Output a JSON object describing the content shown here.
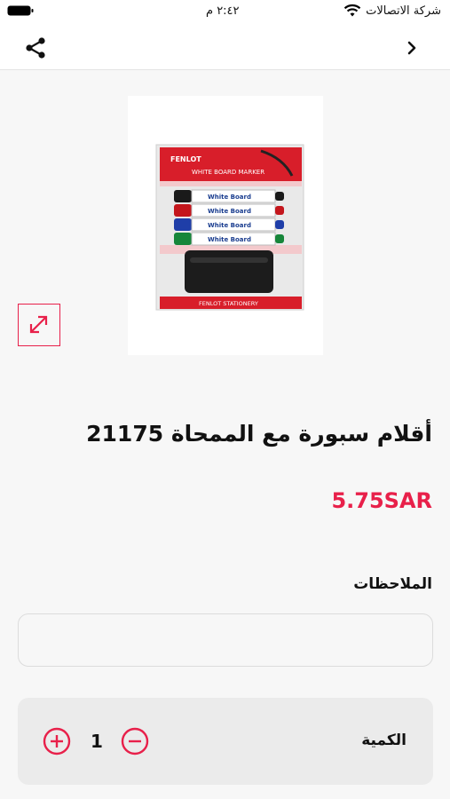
{
  "status_bar": {
    "carrier": "شركة الاتصالات",
    "time": "٢:٤٢ م"
  },
  "product": {
    "title": "أقلام سبورة مع الممحاة 21175",
    "price": "5.75SAR",
    "image": {
      "brand": "FENLOT",
      "header": "WHITE BOARD MARKER",
      "footer": "FENLOT STATIONERY",
      "marker_label": "White Board"
    }
  },
  "notes": {
    "label": "الملاحظات",
    "value": "",
    "placeholder": ""
  },
  "quantity": {
    "label": "الكمية",
    "value": "1"
  },
  "colors": {
    "accent": "#e8204a",
    "background": "#f7f7f7",
    "panel": "#ebebeb"
  }
}
